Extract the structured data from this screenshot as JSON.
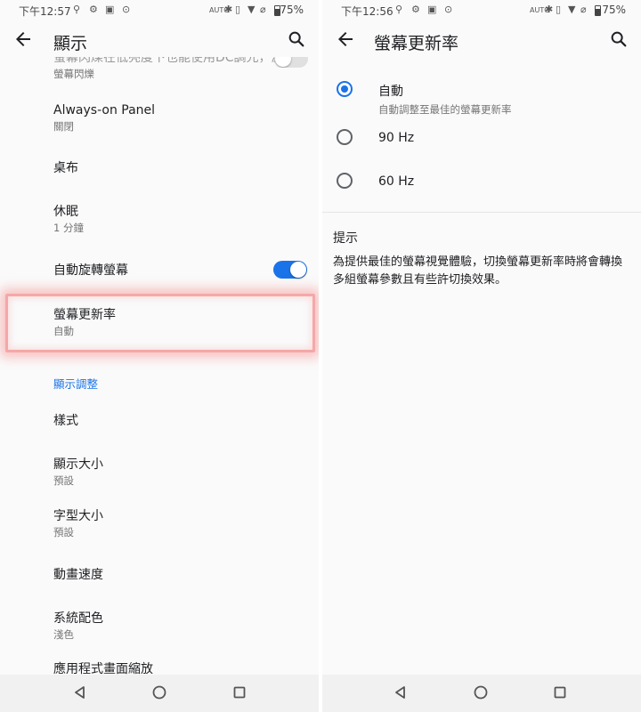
{
  "left": {
    "status": {
      "time": "下午12:57",
      "battery": "75%"
    },
    "appbar": {
      "title": "顯示"
    },
    "cut_row": {
      "title": "螢幕閃爍在低亮度下也能使用DC調光，減緩",
      "subtitle": "螢幕閃爍"
    },
    "rows": [
      {
        "title": "Always-on Panel",
        "subtitle": "關閉"
      },
      {
        "title": "桌布"
      },
      {
        "title": "休眠",
        "subtitle": "1 分鐘"
      },
      {
        "title": "自動旋轉螢幕"
      },
      {
        "title": "螢幕更新率",
        "subtitle": "自動"
      }
    ],
    "section": "顯示調整",
    "rows2": [
      {
        "title": "樣式"
      },
      {
        "title": "顯示大小",
        "subtitle": "預設"
      },
      {
        "title": "字型大小",
        "subtitle": "預設"
      },
      {
        "title": "動畫速度"
      },
      {
        "title": "系統配色",
        "subtitle": "淺色"
      },
      {
        "title": "應用程式畫面縮放"
      }
    ],
    "toggles": {
      "flicker": false,
      "auto_rotate": true
    }
  },
  "right": {
    "status": {
      "time": "下午12:56",
      "battery": "75%"
    },
    "appbar": {
      "title": "螢幕更新率"
    },
    "options": [
      {
        "label": "自動",
        "subtitle": "自動調整至最佳的螢幕更新率",
        "selected": true
      },
      {
        "label": "90 Hz",
        "selected": false
      },
      {
        "label": "60 Hz",
        "selected": false
      }
    ],
    "tip": {
      "title": "提示",
      "body": "為提供最佳的螢幕視覺體驗，切換螢幕更新率時將會轉換多組螢幕參數且有些許切換效果。"
    }
  },
  "colors": {
    "accent": "#1a73e8",
    "highlight": "#f5a7a7",
    "toggle_off": "#e0e0e0"
  },
  "icons": [
    "back-arrow-icon",
    "search-icon",
    "back-triangle-icon",
    "home-circle-icon",
    "recents-square-icon"
  ]
}
